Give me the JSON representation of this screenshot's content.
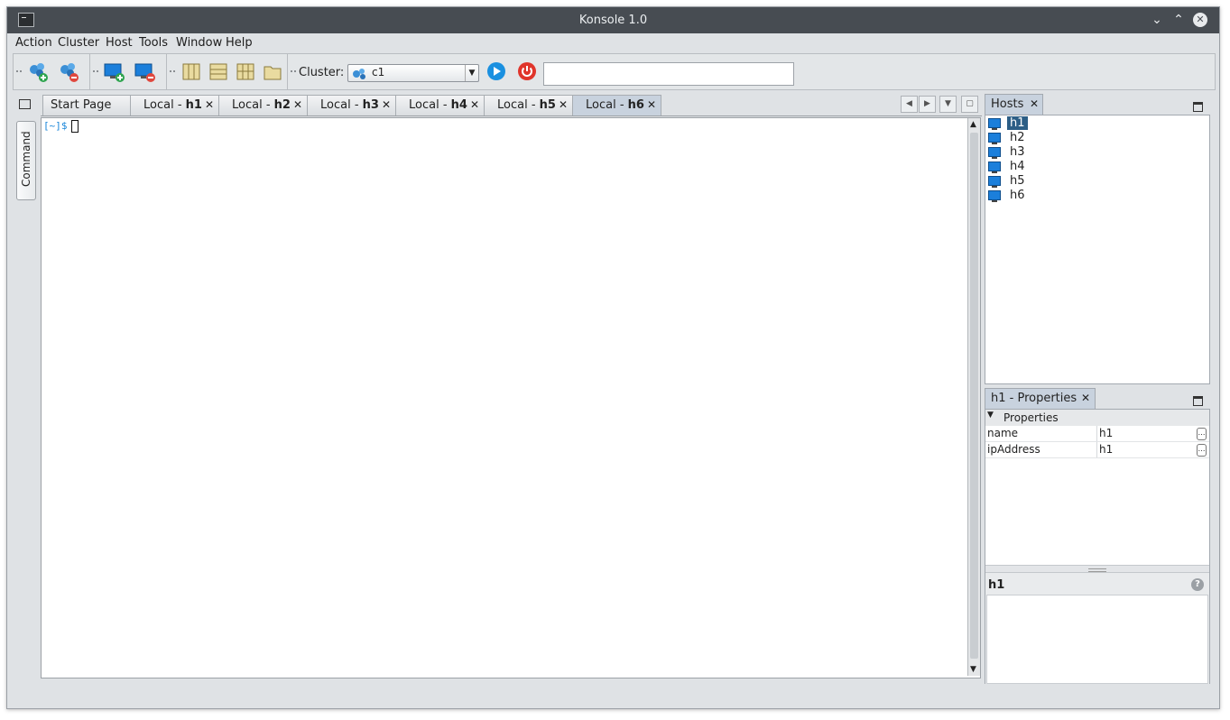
{
  "window": {
    "title": "Konsole 1.0"
  },
  "window_controls": {
    "minimize": "⌄",
    "maximize": "⌃",
    "close": "✕"
  },
  "menu": [
    {
      "label": "Action"
    },
    {
      "label": "Cluster"
    },
    {
      "label": "Host"
    },
    {
      "label": "Tools"
    },
    {
      "label": "Window"
    },
    {
      "label": "Help"
    }
  ],
  "toolbar": {
    "cluster_label": "Cluster:",
    "cluster_value": "c1",
    "command_value": ""
  },
  "sidebar": {
    "command_tab": "Command"
  },
  "tabs": [
    {
      "prefix": "Start Page",
      "bold": ""
    },
    {
      "prefix": "Local - ",
      "bold": "h1"
    },
    {
      "prefix": "Local - ",
      "bold": "h2"
    },
    {
      "prefix": "Local - ",
      "bold": "h3"
    },
    {
      "prefix": "Local - ",
      "bold": "h4"
    },
    {
      "prefix": "Local - ",
      "bold": "h5"
    },
    {
      "prefix": "Local - ",
      "bold": "h6"
    }
  ],
  "terminal": {
    "prompt": "[~]$"
  },
  "hosts_panel": {
    "title": "Hosts",
    "items": [
      "h1",
      "h2",
      "h3",
      "h4",
      "h5",
      "h6"
    ],
    "selected": "h1"
  },
  "properties_panel": {
    "title": "h1 - Properties",
    "section": "Properties",
    "rows": [
      {
        "key": "name",
        "value": "h1"
      },
      {
        "key": "ipAddress",
        "value": "h1"
      }
    ],
    "description_title": "h1"
  },
  "colors": {
    "accent": "#2c5e86",
    "titlebar": "#474c52",
    "prompt": "#1a86d9"
  }
}
